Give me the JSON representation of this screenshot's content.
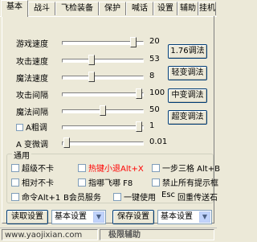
{
  "tabs": [
    {
      "label": "基本",
      "active": true
    },
    {
      "label": "战斗",
      "active": false
    },
    {
      "label": "飞检装备",
      "active": false
    },
    {
      "label": "保护",
      "active": false
    },
    {
      "label": "喊话",
      "active": false
    },
    {
      "label": "设置",
      "active": false
    },
    {
      "label": "辅助",
      "active": false
    },
    {
      "label": "挂机",
      "active": false
    }
  ],
  "sliders": [
    {
      "label": "游戏速度",
      "value": "20",
      "level": 0.9
    },
    {
      "label": "攻击速度",
      "value": "53",
      "level": 0.35
    },
    {
      "label": "魔法速度",
      "value": "8",
      "level": 0.35
    },
    {
      "label": "攻击间隔",
      "value": "100",
      "level": 0.98
    },
    {
      "label": "魔法间隔",
      "value": "50",
      "level": 0.5
    },
    {
      "label": "A粗调",
      "value": "1",
      "level": 0.98
    },
    {
      "label": "A 变微调",
      "value": "0.01",
      "level": 0.02
    }
  ],
  "right_buttons": {
    "b1": "1.76调法",
    "b2": "轻变调法",
    "b3": "中变调法",
    "b4": "超变调法"
  },
  "general": {
    "title": "通用",
    "opt1": "超级不卡",
    "opt2": "热键小退Alt+X",
    "opt3": "一步三格 Alt+B",
    "opt4": "相对不卡",
    "opt5": "指哪飞哪 F8",
    "opt6": "禁止所有提示框",
    "opt7": "命令Alt+1",
    "opt8": "B会员服务",
    "opt9": "一键使用",
    "opt10": "Esc",
    "opt11": "回重传送石"
  },
  "bottom": {
    "read_btn": "读取设置",
    "select1": "基本设置",
    "save_btn": "保存设置",
    "select2": "基本设置"
  },
  "status": {
    "url": "www.yaojixian.com",
    "label": "极限辅助"
  },
  "colors": {
    "accent_red": "#ff0000",
    "bg": "#ece9d8"
  }
}
